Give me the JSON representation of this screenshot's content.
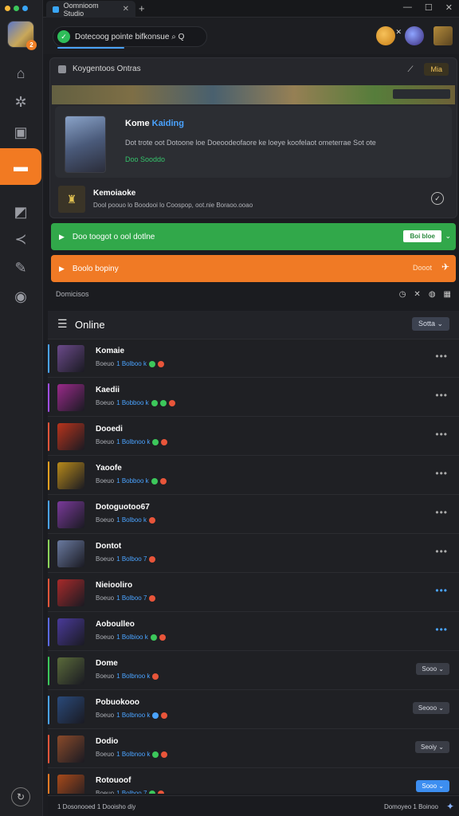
{
  "window": {
    "tab_title": "Oomnioom Studio",
    "tab_close": "✕",
    "new_tab": "+",
    "controls": [
      "—",
      "☐",
      "✕"
    ]
  },
  "sidebar": {
    "traffic_colors": [
      "#f7b93b",
      "#3cc75b",
      "#39a6f7"
    ],
    "avatar_badge": "2",
    "items": [
      {
        "icon": "home-icon",
        "glyph": "⌂"
      },
      {
        "icon": "gear-icon",
        "glyph": "✲"
      },
      {
        "icon": "book-icon",
        "glyph": "▣"
      },
      {
        "icon": "chat-icon",
        "glyph": "▬",
        "active": true
      },
      {
        "icon": "bookmark-icon",
        "glyph": "◩"
      },
      {
        "icon": "share-icon",
        "glyph": "≺"
      },
      {
        "icon": "pen-icon",
        "glyph": "✎"
      },
      {
        "icon": "globe-icon",
        "glyph": "◉"
      }
    ],
    "bottom_icon": "↻"
  },
  "header": {
    "search_text": "Dotecoog pointe bifkonsue ⌕ Q",
    "search_icon": "✓"
  },
  "featured": {
    "heading": "Koygentoos Ontras",
    "pill": "Mia",
    "live": {
      "title_prefix": "Kome",
      "title_highlight": "Kaiding",
      "description": "Dot trote  oot Dotoone  loe  Doeoodeofaore  ke  loeye  koofelaot  ometerrae  Sot  ote",
      "meta": "Doo Sooddo"
    },
    "sub": {
      "title": "Kemoiaoke",
      "description": "Dool poouo lo Boodooi lo Coospop, oot.nie Boraoo.ooao"
    }
  },
  "status_green": {
    "text": "Doo toogot o ool dotlne",
    "action": "Boi bloe"
  },
  "status_orange": {
    "text": "Boolo bopiny",
    "right": "Dooot"
  },
  "section": {
    "label": "Domicisos"
  },
  "online": {
    "title": "Online",
    "sort": "Sotta",
    "rows": [
      {
        "name": "Komaie",
        "sub": "Boeuo",
        "link": "1 Bolboo  k",
        "dots": [
          "#3cc75b",
          "#e8553a"
        ],
        "accent": "#4aa3ff",
        "action": "more",
        "av": "#6b4a8a"
      },
      {
        "name": "Kaedii",
        "sub": "Boeuo",
        "link": "1 Bobboo  k",
        "dots": [
          "#3cc75b",
          "#3cc75b",
          "#e8553a"
        ],
        "accent": "#a04ee8",
        "action": "more",
        "av": "#9a2a8a"
      },
      {
        "name": "Dooedi",
        "sub": "Boeuo",
        "link": "1 Bolbnoo k",
        "dots": [
          "#3cc75b",
          "#e8553a"
        ],
        "accent": "#e8553a",
        "action": "more",
        "av": "#b8341c"
      },
      {
        "name": "Yaoofe",
        "sub": "Boeuo",
        "link": "1 Bobboo k",
        "dots": [
          "#3cc75b",
          "#e8553a"
        ],
        "accent": "#f0a020",
        "action": "more",
        "av": "#b88a1a"
      },
      {
        "name": "Dotoguotoo67",
        "sub": "Boeuo",
        "link": "1 Bolboo  k",
        "dots": [
          "#e8553a"
        ],
        "accent": "#4aa3ff",
        "action": "more",
        "av": "#7a3a9a"
      },
      {
        "name": "Dontot",
        "sub": "Boeuo",
        "link": "1 Bolboo  7",
        "dots": [
          "#e8553a"
        ],
        "accent": "#8bd35a",
        "action": "more",
        "av": "#6a7aa0"
      },
      {
        "name": "Nieiooliro",
        "sub": "Boeuo",
        "link": "1 Bolboo 7",
        "dots": [
          "#e8553a"
        ],
        "accent": "#e8553a",
        "action": "more-blue",
        "av": "#a82a2a"
      },
      {
        "name": "Aoboulleo",
        "sub": "Boeuo",
        "link": "1 Bolbioo k",
        "dots": [
          "#3cc75b",
          "#e8553a"
        ],
        "accent": "#5a6ae8",
        "action": "more-blue",
        "av": "#4a3a9a"
      },
      {
        "name": "Dome",
        "sub": "Boeuo",
        "link": "1 Bolbnoo k",
        "dots": [
          "#e8553a"
        ],
        "accent": "#3cc75b",
        "action": "Sooo",
        "av": "#5a6a3a"
      },
      {
        "name": "Pobuokooo",
        "sub": "Boeuo",
        "link": "1 Bolbnoo k",
        "dots": [
          "#4aa3ff",
          "#e8553a"
        ],
        "accent": "#4aa3ff",
        "action": "Seooo",
        "av": "#2a4a7a"
      },
      {
        "name": "Dodio",
        "sub": "Boeuo",
        "link": "1 Bolbnoo k",
        "dots": [
          "#3cc75b",
          "#e8553a"
        ],
        "accent": "#e8553a",
        "action": "Seoiy",
        "av": "#8a4a2a"
      },
      {
        "name": "Rotouoof",
        "sub": "Boeuo",
        "link": "1 Bolboo  7",
        "dots": [
          "#3cc75b",
          "#e8553a"
        ],
        "accent": "#f07a25",
        "action": "Sooo-blue",
        "av": "#a84a1a"
      }
    ]
  },
  "footer": {
    "left": "1 Dosonooed 1 Dooisho diy",
    "right": "Domoyeo 1 Boinoo"
  }
}
